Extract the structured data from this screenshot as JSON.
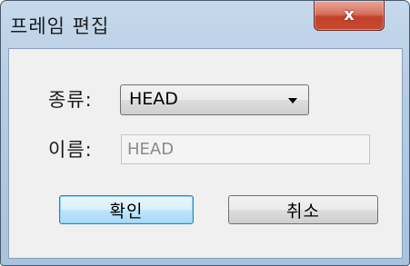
{
  "window": {
    "title": "프레임 편집",
    "close_glyph": "x"
  },
  "form": {
    "type_label": "종류:",
    "type_value": "HEAD",
    "name_label": "이름:",
    "name_value": "HEAD"
  },
  "buttons": {
    "ok_label": "확인",
    "cancel_label": "취소"
  },
  "colors": {
    "titlebar": "#b6cde4",
    "close_button": "#c74a32",
    "client_background": "#f0f0f0",
    "default_button": "#bee6fd"
  }
}
